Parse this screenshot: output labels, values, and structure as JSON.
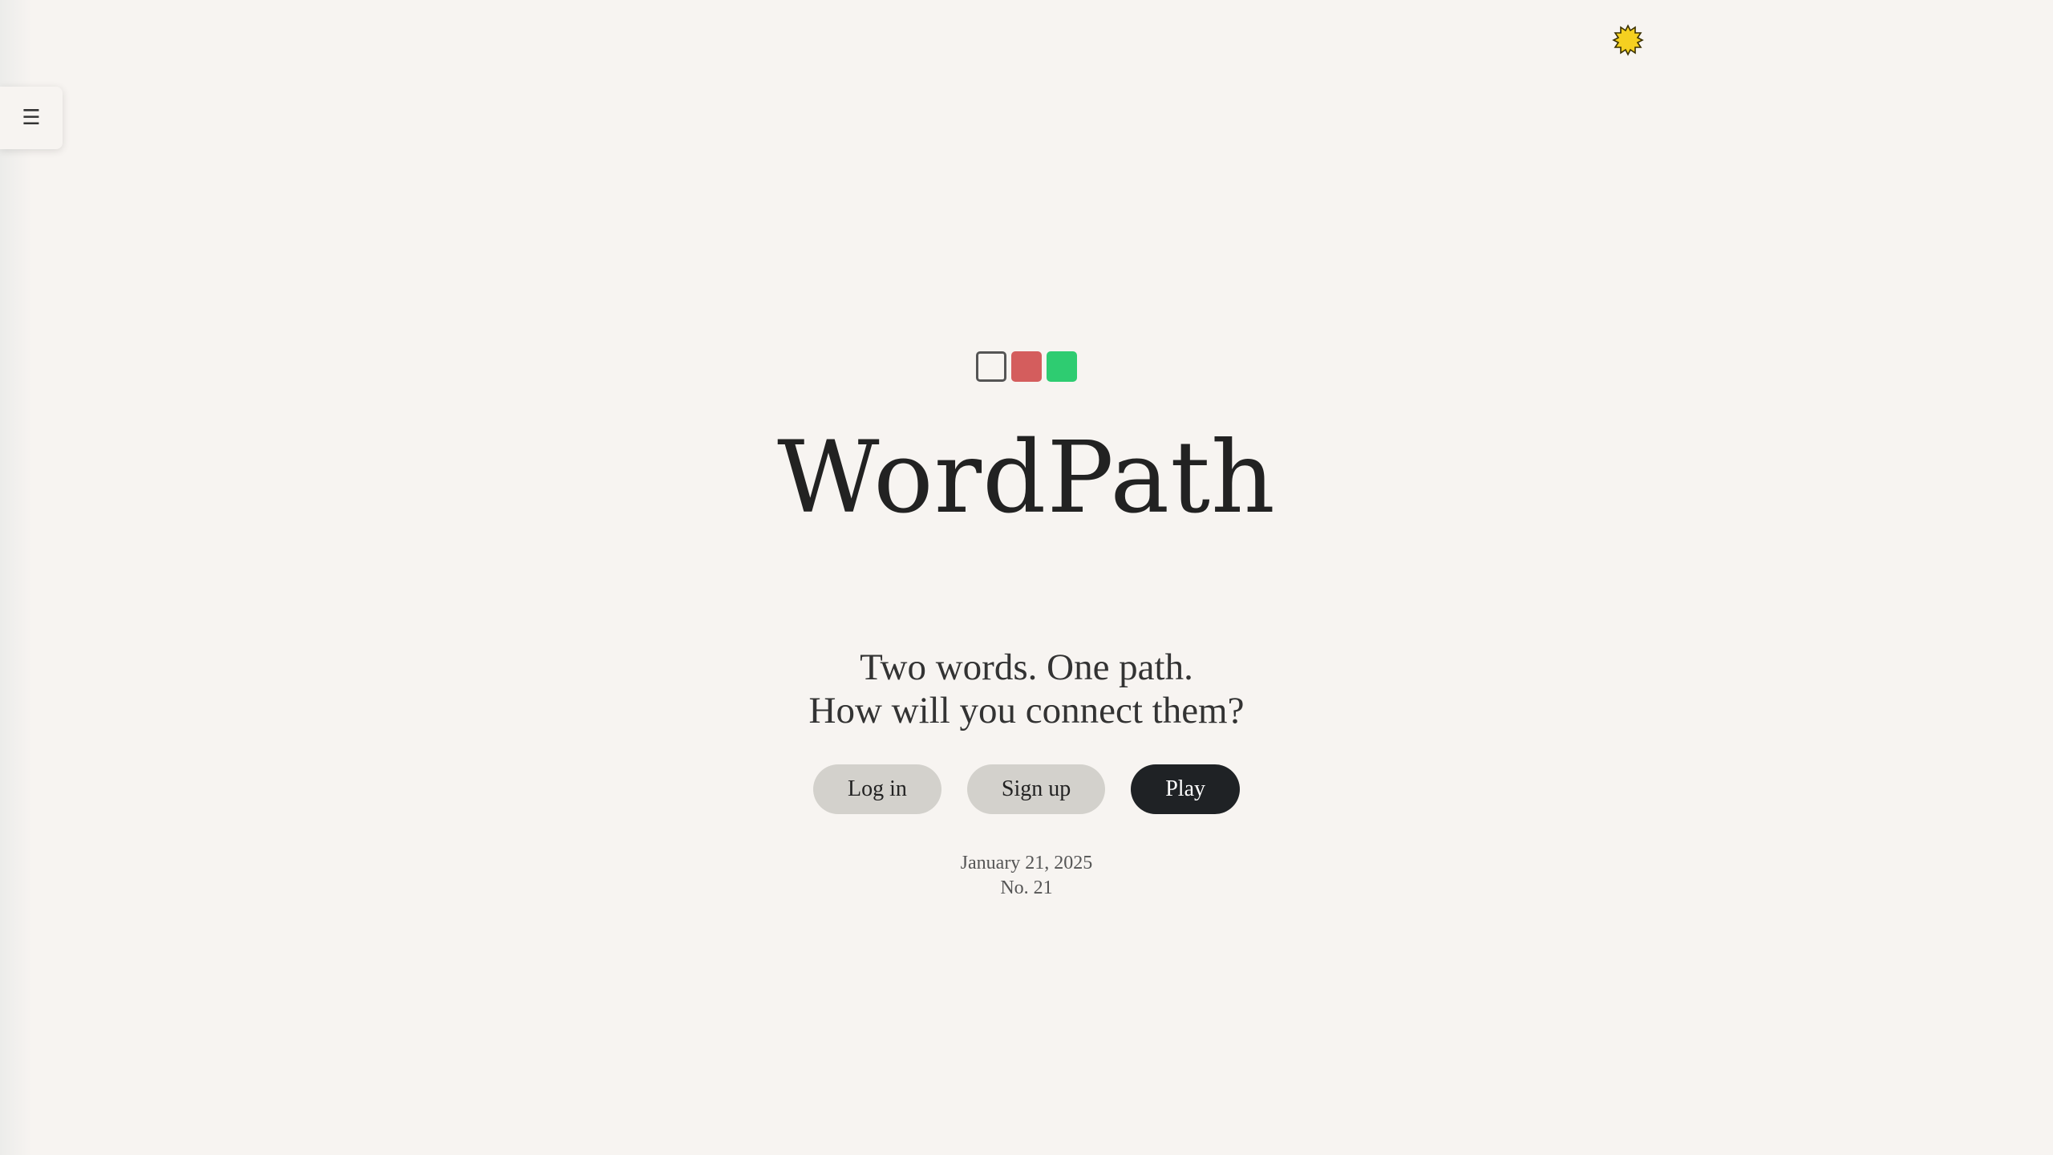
{
  "menu": {
    "icon": "menu-icon",
    "glyph": "☰"
  },
  "theme_toggle": {
    "icon": "sun-icon",
    "color": "#f5d020"
  },
  "logo": {
    "icon": "wordpath-logo-squares",
    "colors": [
      "#ffffff",
      "#d45d5d",
      "#2ecc71"
    ]
  },
  "hero": {
    "title": "WordPath",
    "tagline_line1": "Two words. One path.",
    "tagline_line2": "How will you connect them?"
  },
  "actions": {
    "login_label": "Log in",
    "signup_label": "Sign up",
    "play_label": "Play"
  },
  "puzzle": {
    "date": "January 21, 2025",
    "number": "No. 21"
  }
}
